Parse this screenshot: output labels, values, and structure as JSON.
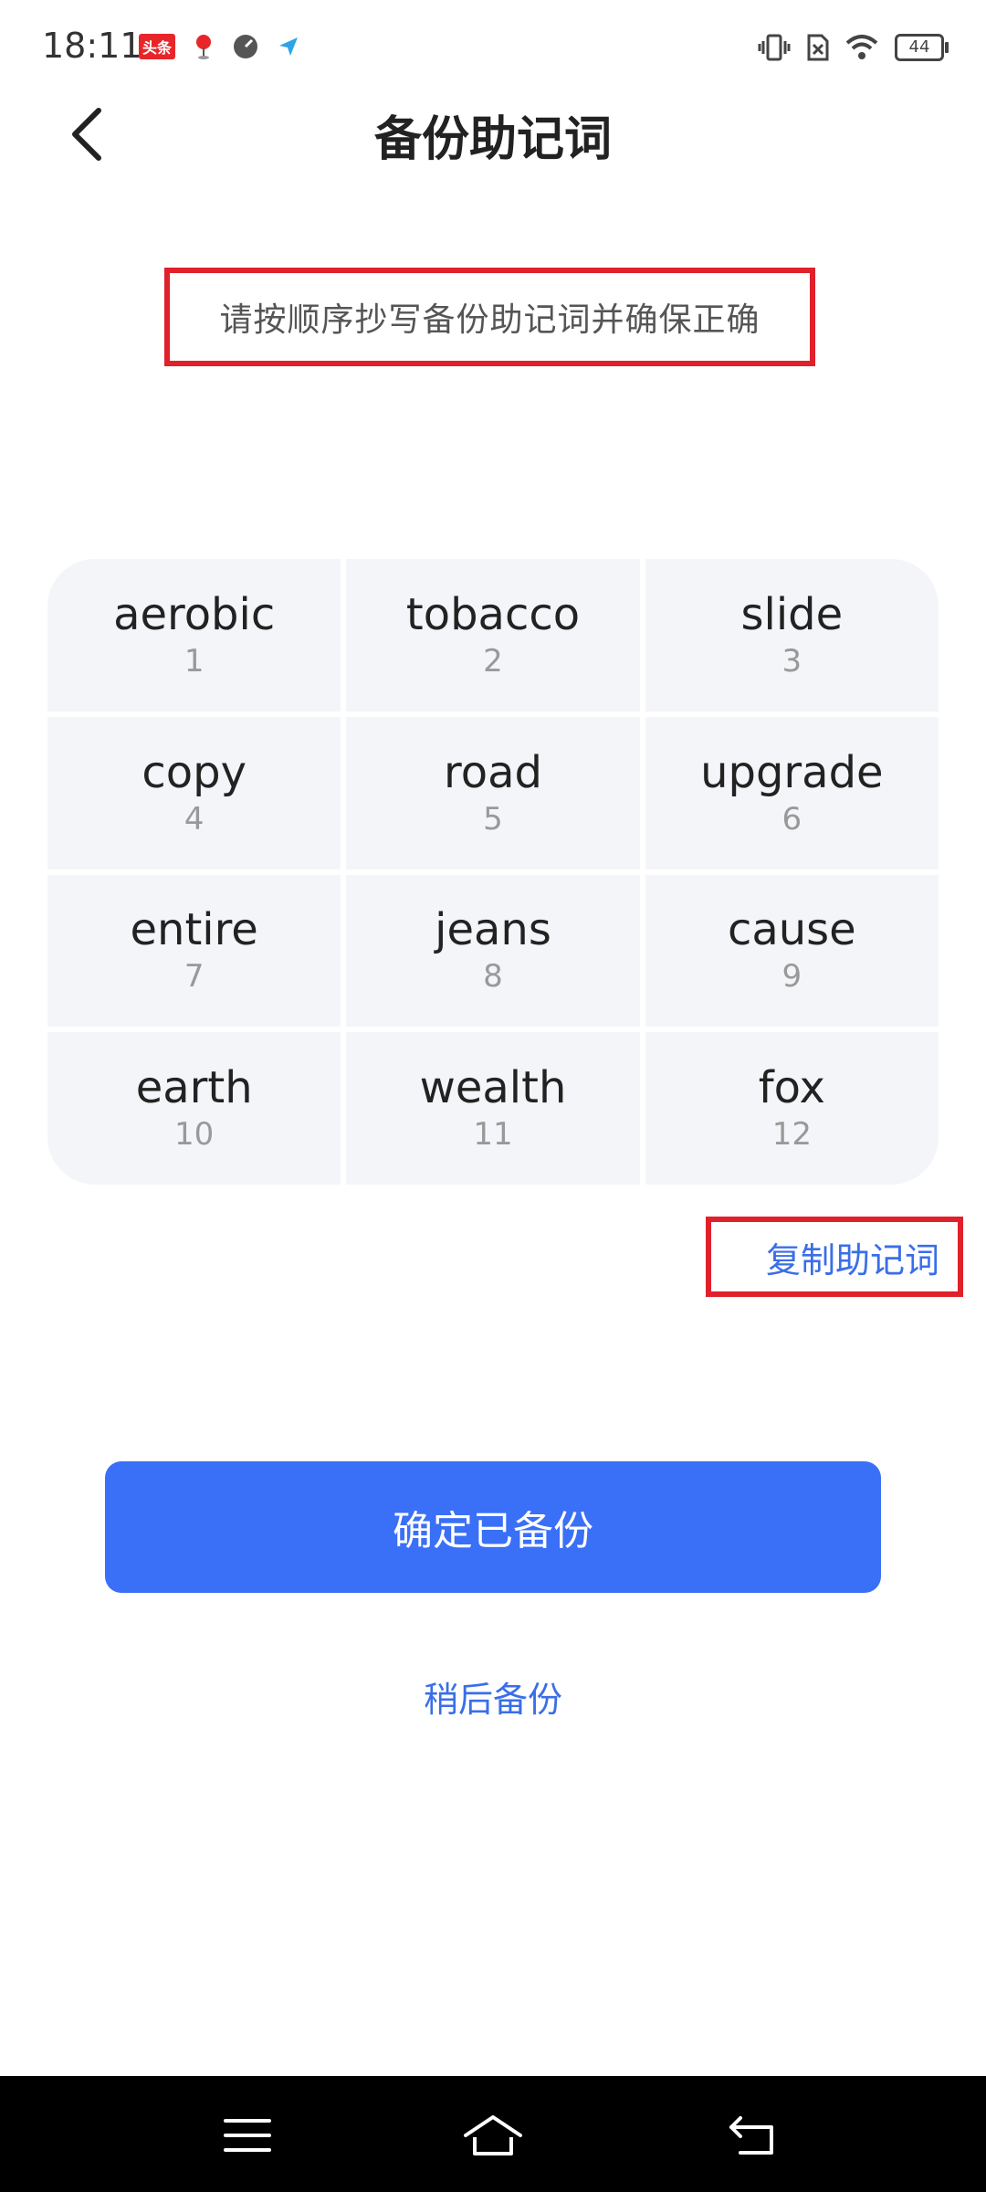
{
  "status_bar": {
    "time": "18:11",
    "notification_badge": "头条",
    "battery_level": "44"
  },
  "header": {
    "title": "备份助记词"
  },
  "instruction": "请按顺序抄写备份助记词并确保正确",
  "mnemonic": {
    "words": [
      {
        "word": "aerobic",
        "index": "1"
      },
      {
        "word": "tobacco",
        "index": "2"
      },
      {
        "word": "slide",
        "index": "3"
      },
      {
        "word": "copy",
        "index": "4"
      },
      {
        "word": "road",
        "index": "5"
      },
      {
        "word": "upgrade",
        "index": "6"
      },
      {
        "word": "entire",
        "index": "7"
      },
      {
        "word": "jeans",
        "index": "8"
      },
      {
        "word": "cause",
        "index": "9"
      },
      {
        "word": "earth",
        "index": "10"
      },
      {
        "word": "wealth",
        "index": "11"
      },
      {
        "word": "fox",
        "index": "12"
      }
    ]
  },
  "actions": {
    "copy_label": "复制助记词",
    "confirm_label": "确定已备份",
    "later_label": "稍后备份"
  },
  "colors": {
    "accent": "#3a6ff7",
    "link": "#3a6ee8",
    "highlight_border": "#e0202a",
    "cell_bg": "#f4f5f8"
  },
  "icons": {
    "back": "chevron-left-icon",
    "nav_menu": "menu-icon",
    "nav_home": "home-icon",
    "nav_back": "back-arrow-icon"
  }
}
